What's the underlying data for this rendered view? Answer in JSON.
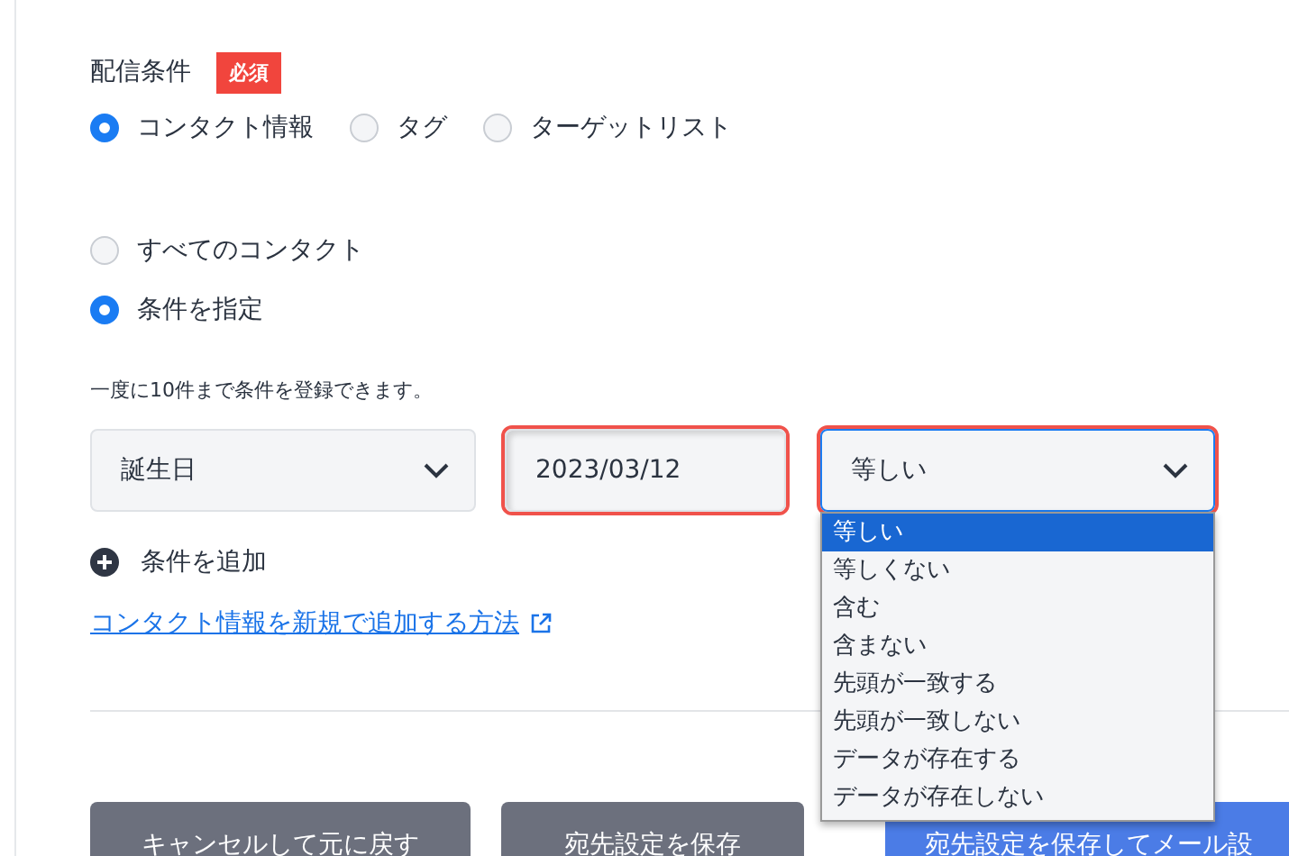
{
  "section": {
    "label": "配信条件",
    "badge": "必須"
  },
  "source_options": [
    {
      "label": "コンタクト情報",
      "selected": true
    },
    {
      "label": "タグ",
      "selected": false
    },
    {
      "label": "ターゲットリスト",
      "selected": false
    }
  ],
  "scope_options": [
    {
      "label": "すべてのコンタクト",
      "selected": false
    },
    {
      "label": "条件を指定",
      "selected": true
    }
  ],
  "hint": "一度に10件まで条件を登録できます。",
  "condition": {
    "field": {
      "value": "誕生日",
      "error": false
    },
    "date": {
      "value": "2023/03/12",
      "error": true
    },
    "operator": {
      "value": "等しい",
      "error": true,
      "open": true,
      "options": [
        {
          "label": "等しい",
          "selected": true
        },
        {
          "label": "等しくない",
          "selected": false
        },
        {
          "label": "含む",
          "selected": false
        },
        {
          "label": "含まない",
          "selected": false
        },
        {
          "label": "先頭が一致する",
          "selected": false
        },
        {
          "label": "先頭が一致しない",
          "selected": false
        },
        {
          "label": "データが存在する",
          "selected": false
        },
        {
          "label": "データが存在しない",
          "selected": false
        }
      ]
    }
  },
  "add_condition": "条件を追加",
  "help_link": "コンタクト情報を新規で追加する方法",
  "buttons": [
    {
      "label": "キャンセルして元に戻す",
      "kind": "secondary"
    },
    {
      "label": "宛先設定を保存",
      "kind": "secondary"
    },
    {
      "label": "宛先設定を保存してメール設",
      "kind": "primary"
    }
  ]
}
